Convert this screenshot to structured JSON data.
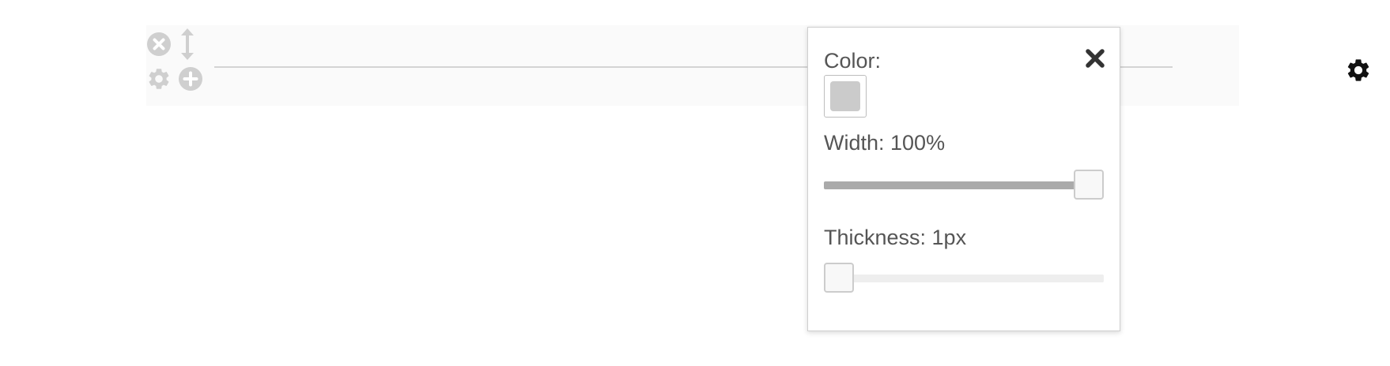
{
  "block": {
    "controls": {
      "remove_icon": "remove-circle-icon",
      "move_icon": "vertical-resize-icon",
      "settings_icon": "gear-icon",
      "add_icon": "add-circle-icon"
    },
    "settings_gear_icon": "gear-icon"
  },
  "popover": {
    "close_icon": "close-x-icon",
    "color_label": "Color:",
    "color_value": "#cbcbcb",
    "width_label": "Width: 100%",
    "width_value_percent": 100,
    "thickness_label": "Thickness: 1px",
    "thickness_value_fraction": 0
  },
  "colors": {
    "control_grey": "#cfcfcf",
    "divider_line": "#d4d4d4",
    "label_text": "#555555",
    "slider_fill": "#aaaaaa",
    "slider_track": "#eeeeee",
    "gear_dark": "#111111"
  }
}
